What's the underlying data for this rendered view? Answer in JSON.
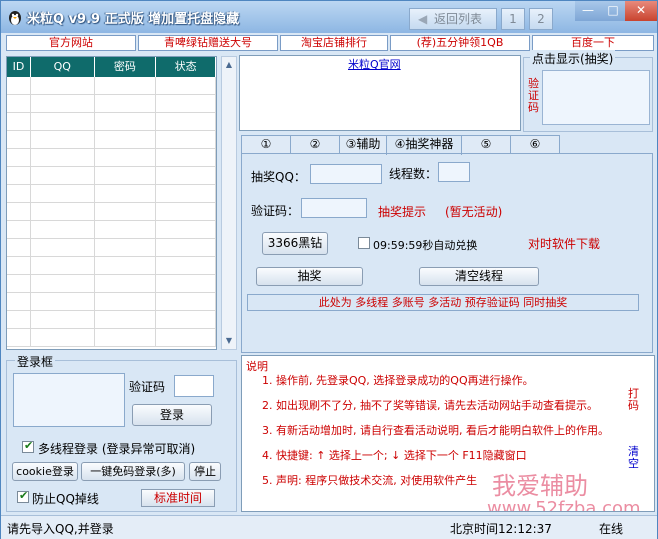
{
  "window": {
    "title": "米粒Q v9.9 正式版   增加置托盘隐藏",
    "back_label": "返回列表",
    "page_buttons": [
      "1",
      "2"
    ]
  },
  "toolbar": {
    "items": [
      "官方网站",
      "青啤绿钻赠送大号",
      "淘宝店铺排行",
      "(荐)五分钟领1QB",
      "百度一下"
    ]
  },
  "account_table": {
    "columns": [
      "ID",
      "QQ",
      "密码",
      "状态"
    ]
  },
  "web_panel": {
    "link": "米粒Q官网"
  },
  "captcha_panel": {
    "legend": "点击显示(抽奖)",
    "label": "验证码"
  },
  "tabs": [
    "①",
    "②",
    "③辅助",
    "④抽奖神器",
    "⑤",
    "⑥"
  ],
  "lottery": {
    "qq_label": "抽奖QQ：",
    "threads_label": "线程数：",
    "captcha_label": "验证码：",
    "hint_label": "抽奖提示",
    "hint_status": "(暂无活动)",
    "btn_3366": "3366黑钻",
    "auto_label": "09:59:59秒自动兑换",
    "sync_time": "对时软件下载",
    "btn_draw": "抽奖",
    "btn_clear": "清空线程",
    "info": "此处为 多线程  多账号  多活动  预存验证码  同时抽奖"
  },
  "login": {
    "legend": "登录框",
    "captcha_label": "验证码",
    "login_btn": "登录",
    "multi_thread": "多线程登录 (登录异常可取消)",
    "cookie_btn": "cookie登录",
    "oneclick_btn": "一键免码登录(多)",
    "stop_btn": "停止",
    "anti_drop": "防止QQ掉线",
    "std_time_btn": "标准时间"
  },
  "notes": {
    "title": "说明",
    "lines": [
      "1. 操作前, 先登录QQ, 选择登录成功的QQ再进行操作。",
      "2. 如出现刷不了分, 抽不了奖等错误, 请先去活动网站手动查看提示。",
      "3. 有新活动增加时, 请自行查看活动说明, 看后才能明白软件上的作用。",
      "4. 快捷键: ↑ 选择上一个;  ↓ 选择下一个     F11隐藏窗口",
      "5. 声明: 程序只做技术交流, 对使用软件产生"
    ],
    "right_1": "打码",
    "right_2": "清空",
    "watermark_cn": "我爱辅助",
    "watermark_url": "www.52fzba.com"
  },
  "status": {
    "message": "请先导入QQ,并登录",
    "time": "北京时间12:12:37",
    "online": "在线"
  }
}
